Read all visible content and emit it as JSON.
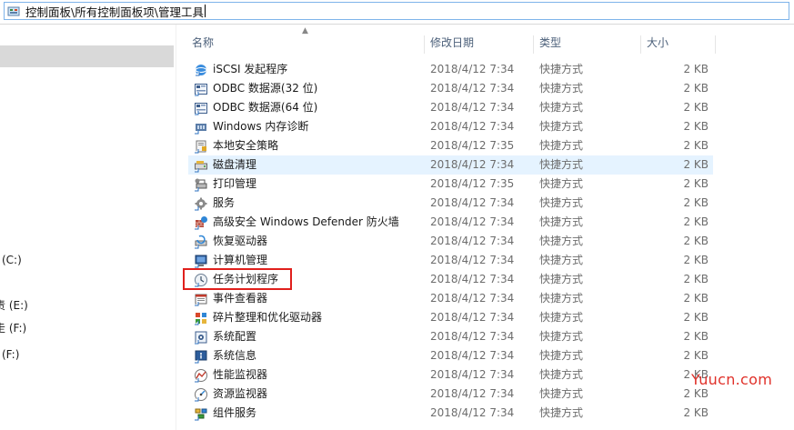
{
  "address": {
    "path_part1": "控制面板",
    "path_part2": "所有控制面板项",
    "path_part3": "管理工具",
    "separator": "\\"
  },
  "nav": {
    "drives": [
      "(C:)",
      "责 (E:)",
      "走 (F:)",
      "(F:)"
    ]
  },
  "columns": {
    "name": "名称",
    "date": "修改日期",
    "type": "类型",
    "size": "大小"
  },
  "files": [
    {
      "name": "iSCSI 发起程序",
      "date": "2018/4/12 7:34",
      "type": "快捷方式",
      "size": "2 KB",
      "icon": "iscsi-icon"
    },
    {
      "name": "ODBC 数据源(32 位)",
      "date": "2018/4/12 7:34",
      "type": "快捷方式",
      "size": "2 KB",
      "icon": "odbc-icon"
    },
    {
      "name": "ODBC 数据源(64 位)",
      "date": "2018/4/12 7:34",
      "type": "快捷方式",
      "size": "2 KB",
      "icon": "odbc-icon"
    },
    {
      "name": "Windows 内存诊断",
      "date": "2018/4/12 7:34",
      "type": "快捷方式",
      "size": "2 KB",
      "icon": "memory-diagnostic-icon"
    },
    {
      "name": "本地安全策略",
      "date": "2018/4/12 7:35",
      "type": "快捷方式",
      "size": "2 KB",
      "icon": "security-policy-icon"
    },
    {
      "name": "磁盘清理",
      "date": "2018/4/12 7:34",
      "type": "快捷方式",
      "size": "2 KB",
      "icon": "disk-cleanup-icon"
    },
    {
      "name": "打印管理",
      "date": "2018/4/12 7:35",
      "type": "快捷方式",
      "size": "2 KB",
      "icon": "print-management-icon"
    },
    {
      "name": "服务",
      "date": "2018/4/12 7:34",
      "type": "快捷方式",
      "size": "2 KB",
      "icon": "services-gear-icon"
    },
    {
      "name": "高级安全 Windows Defender 防火墙",
      "date": "2018/4/12 7:34",
      "type": "快捷方式",
      "size": "2 KB",
      "icon": "firewall-icon"
    },
    {
      "name": "恢复驱动器",
      "date": "2018/4/12 7:34",
      "type": "快捷方式",
      "size": "2 KB",
      "icon": "recovery-drive-icon"
    },
    {
      "name": "计算机管理",
      "date": "2018/4/12 7:34",
      "type": "快捷方式",
      "size": "2 KB",
      "icon": "computer-management-icon"
    },
    {
      "name": "任务计划程序",
      "date": "2018/4/12 7:34",
      "type": "快捷方式",
      "size": "2 KB",
      "icon": "task-scheduler-clock-icon"
    },
    {
      "name": "事件查看器",
      "date": "2018/4/12 7:34",
      "type": "快捷方式",
      "size": "2 KB",
      "icon": "event-viewer-icon"
    },
    {
      "name": "碎片整理和优化驱动器",
      "date": "2018/4/12 7:34",
      "type": "快捷方式",
      "size": "2 KB",
      "icon": "defrag-icon"
    },
    {
      "name": "系统配置",
      "date": "2018/4/12 7:34",
      "type": "快捷方式",
      "size": "2 KB",
      "icon": "system-config-icon"
    },
    {
      "name": "系统信息",
      "date": "2018/4/12 7:34",
      "type": "快捷方式",
      "size": "2 KB",
      "icon": "system-info-icon"
    },
    {
      "name": "性能监视器",
      "date": "2018/4/12 7:34",
      "type": "快捷方式",
      "size": "2 KB",
      "icon": "performance-monitor-icon"
    },
    {
      "name": "资源监视器",
      "date": "2018/4/12 7:34",
      "type": "快捷方式",
      "size": "2 KB",
      "icon": "resource-monitor-icon"
    },
    {
      "name": "组件服务",
      "date": "2018/4/12 7:34",
      "type": "快捷方式",
      "size": "2 KB",
      "icon": "component-services-icon"
    }
  ],
  "watermark": "Yuucn.com",
  "colors": {
    "highlight_box": "#e0201c",
    "hover_row": "#e5f3ff",
    "header_text": "#4c607a"
  }
}
